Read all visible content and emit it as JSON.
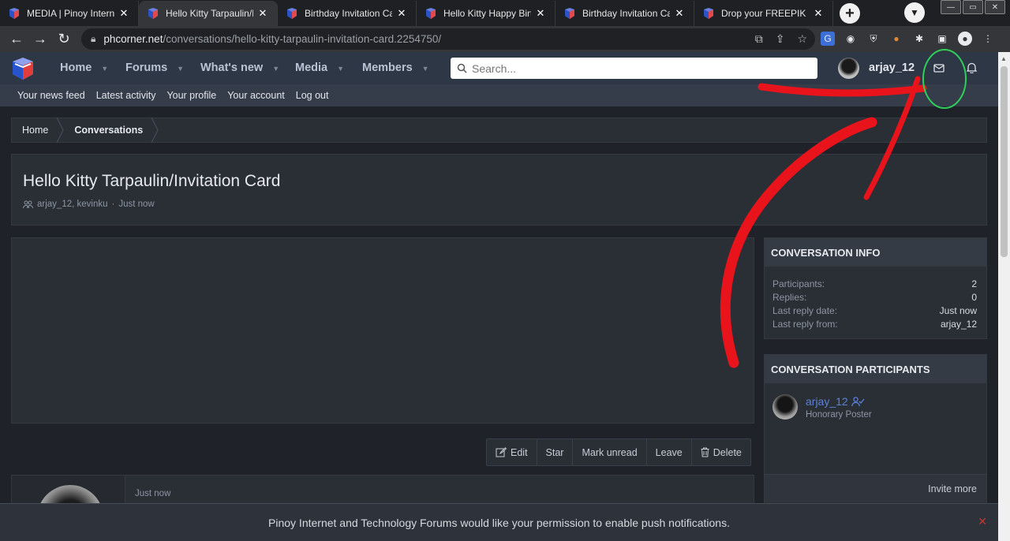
{
  "browser": {
    "tabs": [
      {
        "title": "MEDIA | Pinoy Internet",
        "active": false
      },
      {
        "title": "Hello Kitty Tarpaulin/Inv",
        "active": true
      },
      {
        "title": "Birthday Invitation Card",
        "active": false
      },
      {
        "title": "Hello Kitty Happy Birth",
        "active": false
      },
      {
        "title": "Birthday Invitation Card",
        "active": false
      },
      {
        "title": "Drop your FREEPIK requ",
        "active": false
      }
    ],
    "tab_close": "✕",
    "url_host": "phcorner.net",
    "url_path": "/conversations/hello-kitty-tarpaulin-invitation-card.2254750/"
  },
  "site": {
    "nav": {
      "home": "Home",
      "forums": "Forums",
      "whats_new": "What's new",
      "media": "Media",
      "members": "Members"
    },
    "search_placeholder": "Search...",
    "username": "arjay_12",
    "subnav": [
      "Your news feed",
      "Latest activity",
      "Your profile",
      "Your account",
      "Log out"
    ]
  },
  "breadcrumb": {
    "home": "Home",
    "conversations": "Conversations"
  },
  "conversation": {
    "title": "Hello Kitty Tarpaulin/Invitation Card",
    "participants_meta": "arjay_12, kevinku",
    "meta_sep": "·",
    "time": "Just now"
  },
  "actions": {
    "edit": "Edit",
    "star": "Star",
    "mark_unread": "Mark unread",
    "leave": "Leave",
    "delete": "Delete"
  },
  "post": {
    "time": "Just now"
  },
  "sidebar": {
    "info_title": "CONVERSATION INFO",
    "info": [
      {
        "label": "Participants:",
        "value": "2"
      },
      {
        "label": "Replies:",
        "value": "0"
      },
      {
        "label": "Last reply date:",
        "value": "Just now"
      },
      {
        "label": "Last reply from:",
        "value": "arjay_12"
      }
    ],
    "participants_title": "CONVERSATION PARTICIPANTS",
    "participant": {
      "name": "arjay_12",
      "rank": "Honorary Poster"
    },
    "invite_more": "Invite more"
  },
  "push_notice": "Pinoy Internet and Technology Forums would like your permission to enable push notifications.",
  "push_close": "✕",
  "colors": {
    "accent": "#5b82d6",
    "nav_bg": "#2e3746",
    "annotation_red": "#e8131b",
    "annotation_green": "#2fcf5a"
  }
}
